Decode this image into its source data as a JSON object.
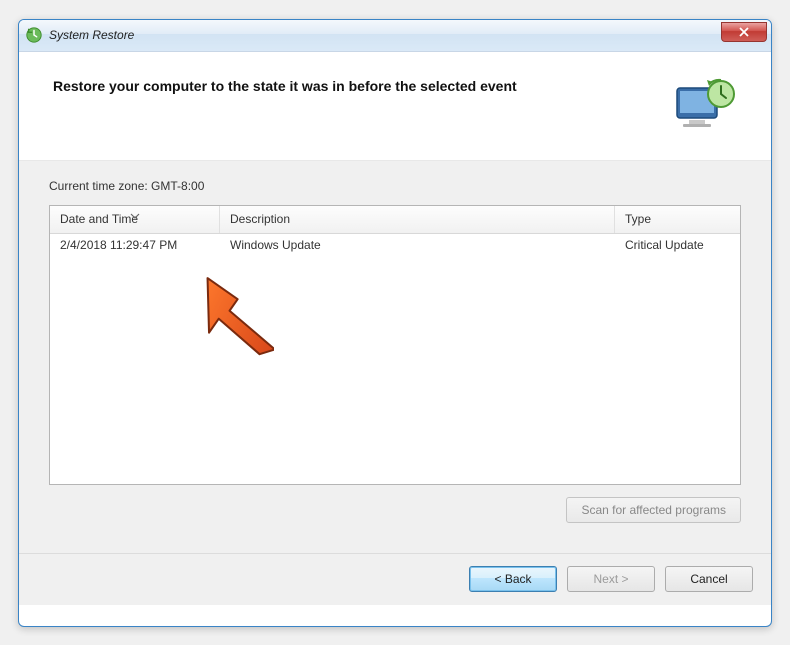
{
  "window": {
    "title": "System Restore",
    "close_icon": "close-icon"
  },
  "header": {
    "title": "Restore your computer to the state it was in before the selected event",
    "icon": "monitor-clock-icon"
  },
  "content": {
    "timezone_label": "Current time zone: GMT-8:00",
    "table": {
      "columns": {
        "date": "Date and Time",
        "description": "Description",
        "type": "Type"
      },
      "rows": [
        {
          "date": "2/4/2018 11:29:47 PM",
          "description": "Windows Update",
          "type": "Critical Update"
        }
      ]
    },
    "scan_button": "Scan for affected programs"
  },
  "footer": {
    "back": "< Back",
    "next": "Next >",
    "cancel": "Cancel"
  }
}
